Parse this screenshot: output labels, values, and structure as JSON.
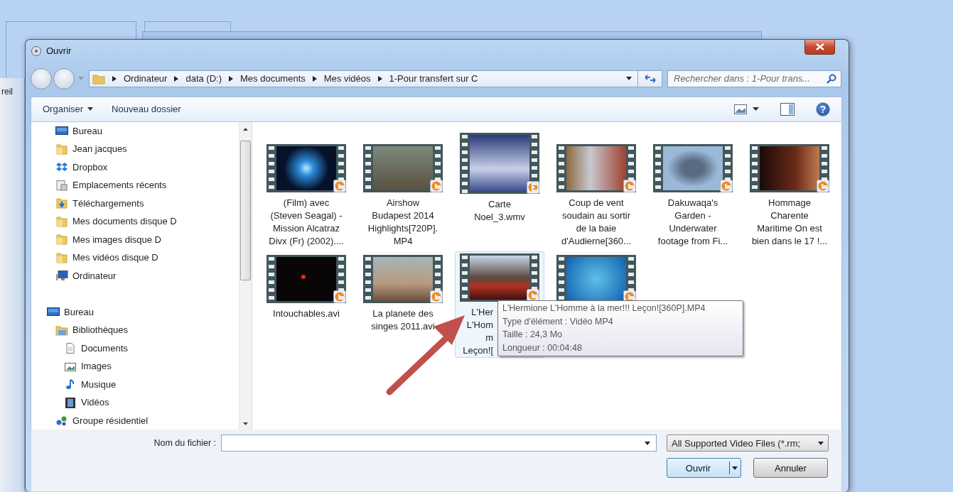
{
  "background": {
    "label": "reil"
  },
  "window": {
    "title": "Ouvrir"
  },
  "address_bar": {
    "segments": [
      "Ordinateur",
      "data (D:)",
      "Mes documents",
      "Mes vidéos",
      "1-Pour transfert sur C"
    ]
  },
  "search": {
    "placeholder": "Rechercher dans : 1-Pour trans..."
  },
  "toolbar": {
    "buttons": [
      {
        "label": "Organiser",
        "kind": "menu"
      },
      {
        "label": "Nouveau dossier",
        "kind": "plain"
      }
    ],
    "help": "?"
  },
  "navigation": {
    "favorites": [
      {
        "label": "Bureau",
        "kind": "desktop"
      },
      {
        "label": "Jean jacques",
        "kind": "folder"
      },
      {
        "label": "Dropbox",
        "kind": "dropbox"
      },
      {
        "label": "Emplacements récents",
        "kind": "recent"
      },
      {
        "label": "Téléchargements",
        "kind": "downloads"
      },
      {
        "label": "Mes documents disque D",
        "kind": "folder"
      },
      {
        "label": "Mes images disque D",
        "kind": "folder"
      },
      {
        "label": "Mes vidéos disque D",
        "kind": "folder"
      },
      {
        "label": "Ordinateur",
        "kind": "computer"
      }
    ],
    "tree": [
      {
        "label": "Bureau",
        "kind": "desktop",
        "children": [
          {
            "label": "Bibliothèques",
            "kind": "library",
            "children": [
              {
                "label": "Documents",
                "kind": "document"
              },
              {
                "label": "Images",
                "kind": "image"
              },
              {
                "label": "Musique",
                "kind": "music"
              },
              {
                "label": "Vidéos",
                "kind": "video"
              }
            ]
          },
          {
            "label": "Groupe résidentiel",
            "kind": "homegroup"
          }
        ]
      }
    ]
  },
  "files": [
    {
      "lines": [
        "(Film) avec",
        "(Steven Seagal) -",
        "Mission Alcatraz",
        "Divx (Fr) (2002)...."
      ],
      "selected": false
    },
    {
      "lines": [
        "Airshow",
        "Budapest 2014",
        "Highlights[720P].",
        "MP4"
      ],
      "selected": false
    },
    {
      "lines": [
        "Carte",
        "Noel_3.wmv"
      ],
      "selected": false
    },
    {
      "lines": [
        "Coup de vent",
        "soudain au sortir",
        "de la baie",
        "d'Audierne[360..."
      ],
      "selected": false
    },
    {
      "lines": [
        "Dakuwaqa's",
        "Garden -",
        "Underwater",
        "footage from Fi..."
      ],
      "selected": false
    },
    {
      "lines": [
        "Hommage",
        "Charente",
        "Maritime   On est",
        "bien dans le 17 !..."
      ],
      "selected": false
    },
    {
      "lines": [
        "Intouchables.avi"
      ],
      "selected": false
    },
    {
      "lines": [
        "La planete des",
        "singes 2011.avi"
      ],
      "selected": false
    },
    {
      "lines": [
        "L'Her",
        "L'Hom",
        "m",
        "Leçon!["
      ],
      "selected": true
    },
    {
      "selected": false
    }
  ],
  "tooltip": {
    "lines": [
      "L'Hermione  L'Homme à la mer!!! Leçon![360P].MP4",
      "Type d'élément : Vidéo MP4",
      "Taille : 24,3 Mo",
      "Longueur : 00:04:48"
    ]
  },
  "footer": {
    "filename_label": "Nom du fichier :",
    "filter": "All Supported Video Files (*.rm;",
    "buttons": [
      {
        "label": "Ouvrir",
        "kind": "split"
      },
      {
        "label": "Annuler",
        "kind": "plain"
      }
    ]
  }
}
